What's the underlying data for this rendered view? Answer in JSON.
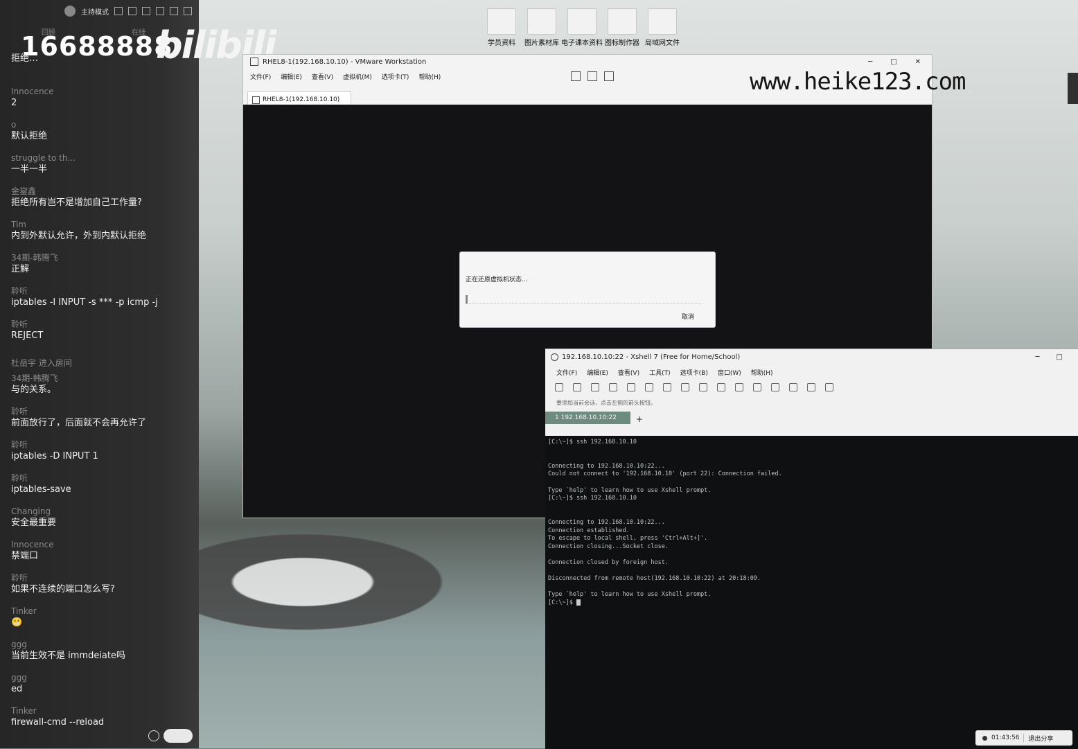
{
  "chat": {
    "topbar": {
      "mode_label": "主持模式"
    },
    "tabs": [
      "回顾",
      "在线"
    ],
    "room_number": "16688888",
    "logo_text": "bilibili",
    "messages": [
      {
        "name": "",
        "text": "拒绝…"
      },
      {
        "name": "Innocence",
        "text": "2"
      },
      {
        "name": "o",
        "text": "默认拒绝"
      },
      {
        "name": "struggle to th...",
        "text": "一半一半"
      },
      {
        "name": "金鋆鑫",
        "text": "拒绝所有岂不是增加自己工作量?"
      },
      {
        "name": "Tim",
        "text": "内到外默认允许，外到内默认拒绝"
      },
      {
        "name": "34期-韩腾飞",
        "text": "正解"
      },
      {
        "name": "聆听",
        "text": "iptables -I INPUT -s *** -p icmp -j"
      },
      {
        "name": "聆听",
        "text": "REJECT"
      },
      {
        "system": true,
        "name": "杜岳宇 进入房间",
        "text": ""
      },
      {
        "name": "34期-韩腾飞",
        "text": "与的关系。"
      },
      {
        "name": "聆听",
        "text": "前面放行了，后面就不会再允许了"
      },
      {
        "name": "聆听",
        "text": "iptables -D INPUT 1"
      },
      {
        "name": "聆听",
        "text": "iptables-save"
      },
      {
        "name": "Changing",
        "text": "安全最重要"
      },
      {
        "name": "Innocence",
        "text": "禁端口"
      },
      {
        "name": "聆听",
        "text": "如果不连续的端口怎么写?"
      },
      {
        "name": "Tinker",
        "text": "😬"
      },
      {
        "name": "ggg",
        "text": "当前生效不是 immdeiate吗"
      },
      {
        "name": "ggg",
        "text": "ed"
      },
      {
        "name": "Tinker",
        "text": "firewall-cmd --reload"
      }
    ]
  },
  "desktop": {
    "icons": [
      "学员资料",
      "图片素材库",
      "电子课本资料",
      "图标制作器",
      "局域网文件"
    ]
  },
  "watermark": "www.heike123.com",
  "vmware": {
    "title": "RHEL8-1(192.168.10.10) - VMware Workstation",
    "menu": [
      "文件(F)",
      "编辑(E)",
      "查看(V)",
      "虚拟机(M)",
      "选项卡(T)",
      "帮助(H)"
    ],
    "tab_label": "RHEL8-1(192.168.10.10)",
    "controls": [
      "─",
      "□",
      "✕"
    ],
    "dialog": {
      "message": "正在还原虚拟机状态…",
      "progress": 0.01,
      "cancel_label": "取消"
    }
  },
  "xshell": {
    "title": "192.168.10.10:22 - Xshell 7 (Free for Home/School)",
    "menu": [
      "文件(F)",
      "编辑(E)",
      "查看(V)",
      "工具(T)",
      "选项卡(B)",
      "窗口(W)",
      "帮助(H)"
    ],
    "hint": "要添加当前会话，点击左侧的箭头按钮。",
    "session_tab": "1 192.168.10.10:22",
    "add_tab": "+",
    "terminal_lines": [
      "[C:\\~]$ ssh 192.168.10.10",
      "",
      "",
      "Connecting to 192.168.10.10:22...",
      "Could not connect to '192.168.10.10' (port 22): Connection failed.",
      "",
      "Type `help' to learn how to use Xshell prompt.",
      "[C:\\~]$ ssh 192.168.10.10",
      "",
      "",
      "Connecting to 192.168.10.10:22...",
      "Connection established.",
      "To escape to local shell, press 'Ctrl+Alt+]'.",
      "Connection closing...Socket close.",
      "",
      "Connection closed by foreign host.",
      "",
      "Disconnected from remote host(192.168.10.10:22) at 20:18:09.",
      "",
      "Type `help' to learn how to use Xshell prompt.",
      "[C:\\~]$ "
    ]
  },
  "share": {
    "time": "01:43:56",
    "exit_label": "退出分享"
  }
}
